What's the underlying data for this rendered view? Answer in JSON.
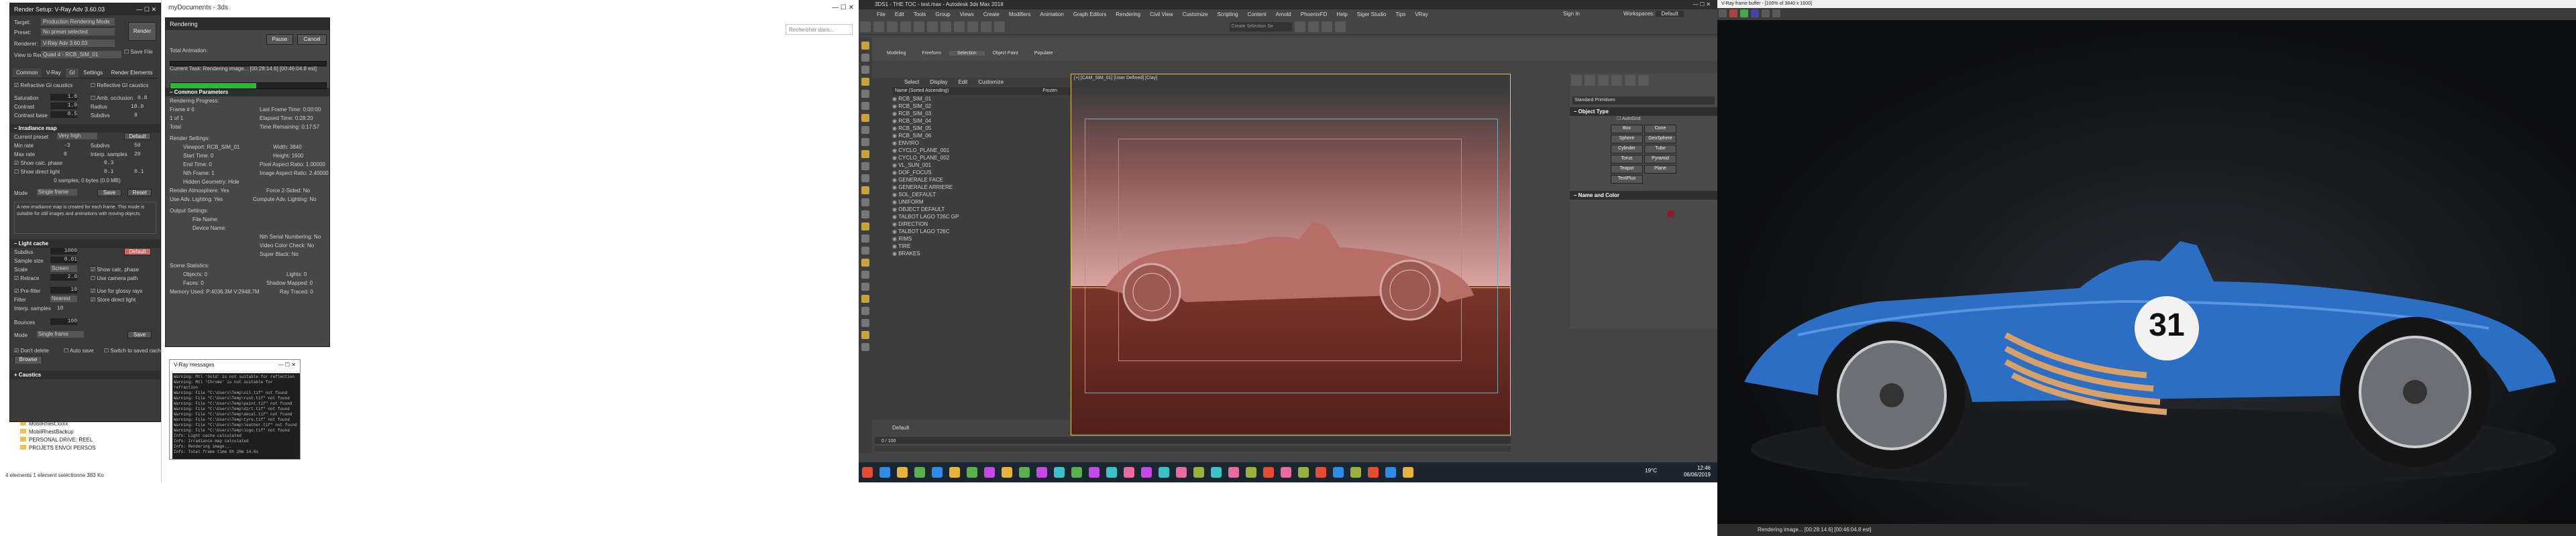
{
  "explorer": {
    "path": "myDocuments - 3ds",
    "search_placeholder": "Rechercher dans...",
    "folders": [
      "MobilRhest.xxxx",
      "MobilRhestBackup",
      "PERSONAL DRIVE: REEL",
      "PROJETS ENVOI PERSOS"
    ],
    "status": "4 elements   1 element selectionne 383 Ko"
  },
  "render_setup": {
    "title": "Render Setup: V-Ray Adv 3.60.03",
    "target_label": "Target:",
    "target_value": "Production Rendering Mode",
    "preset_label": "Preset:",
    "preset_value": "No preset selected",
    "renderer_label": "Renderer:",
    "renderer_value": "V-Ray Adv 3.60.03",
    "view_label": "View to Render:",
    "view_value": "Quad 4 - RCB_SIM_01",
    "render_button": "Render",
    "save_file": "Save File",
    "tabs": [
      "Common",
      "V-Ray",
      "GI",
      "Settings",
      "Render Elements"
    ],
    "refractive_gi": "Refractive GI caustics",
    "reflective_gi": "Reflective GI caustics",
    "saturation_label": "Saturation",
    "saturation_value": "1.0",
    "contrast_label": "Contrast",
    "contrast_value": "1.0",
    "contrast_base_label": "Contrast base",
    "contrast_base_value": "0.5",
    "amb_occlusion": "Amb. occlusion",
    "amb_value": "0.8",
    "radius_label": "Radius",
    "radius_value": "10.0",
    "subdivs_label": "Subdivs",
    "subdivs_value": "8",
    "irradiance_title": "Irradiance map",
    "current_preset_label": "Current preset",
    "current_preset_value": "Very high",
    "default_btn": "Default",
    "min_rate_label": "Min rate",
    "min_rate_value": "-3",
    "max_rate_label": "Max rate",
    "max_rate_value": "0",
    "subdivs2_value": "50",
    "interp_label": "Interp. samples",
    "interp_value": "20",
    "color_thresh_value": "0.3",
    "normal_thresh_value": "0.1",
    "dist_thresh_value": "0.1",
    "show_calc": "Show calc. phase",
    "show_direct": "Show direct light",
    "samples_info": "0 samples; 0 bytes (0.0 MB)",
    "mode_label": "Mode",
    "mode_value": "Single frame",
    "save_btn": "Save",
    "reset_btn": "Reset",
    "info_text": "A new irradiance map is created for each frame. This mode is suitable for still images and animations with moving objects.",
    "light_cache_title": "Light cache",
    "lc_subdivs_label": "Subdivs",
    "lc_subdivs_value": "1000",
    "lc_sample_label": "Sample size",
    "lc_sample_value": "0.01",
    "lc_scale_label": "Scale",
    "lc_scale_value": "Screen",
    "lc_retrace_label": "Retrace",
    "lc_retrace_value": "2.0",
    "show_calc2": "Show calc. phase",
    "use_camera": "Use camera path",
    "pre_filter": "Pre-filter",
    "pre_filter_value": "10",
    "filter_label": "Filter",
    "filter_value": "Nearest",
    "use_glossy": "Use for glossy rays",
    "store_direct": "Store direct light",
    "interp_samples_value": "10",
    "bounces_label": "Bounces",
    "bounces_value": "100",
    "mode2_value": "Single frame",
    "save2": "Save",
    "caustics_title": "Caustics",
    "auto_switch": "Don't delete",
    "auto_save": "Auto save",
    "switch_to_saved": "Switch to saved cache",
    "browse": "Browse"
  },
  "rendering_dialog": {
    "title": "Rendering",
    "pause": "Pause",
    "cancel": "Cancel",
    "total_animation": "Total Animation:",
    "current_task": "Current Task: Rendering image... [00:28:14.6] [00:46:04.8 est]",
    "progress": 0.55,
    "common_params": "Common Parameters",
    "rendering_progress": "Rendering Progress:",
    "frame_label": "Frame #",
    "frame_value": "0",
    "of_label": "1 of 1",
    "total_label": "Total",
    "last_frame_time": "Last Frame Time: 0:00:00",
    "elapsed_time": "Elapsed Time: 0:28:20",
    "time_remaining": "Time Remaining: 0:17:57",
    "render_settings": "Render Settings:",
    "viewport": "Viewport: RCB_SIM_01",
    "width": "Width: 3840",
    "height": "Height: 1600",
    "start_time": "Start Time: 0",
    "pixel_aspect": "Pixel Aspect Ratio: 1.00000",
    "end_time": "End Time: 0",
    "image_aspect": "Image Aspect Ratio: 2.40000",
    "nth_frame": "Nth Frame: 1",
    "hidden_geometry": "Hidden Geometry: Hide",
    "render_atmos": "Render Atmosphere: Yes",
    "force_2sided": "Force 2-Sided: No",
    "area_lights": "Use Adv. Lighting: Yes",
    "compute_adv": "Compute Adv. Lighting: No",
    "output_settings": "Output Settings:",
    "file_name": "File Name:",
    "device_name": "Device Name:",
    "nth_serial": "Nth Serial Numbering: No",
    "output_video": "Video Color Check: No",
    "super_black": "Super Black: No",
    "scene_statistics": "Scene Statistics:",
    "objects": "Objects: 0",
    "lights": "Lights: 0",
    "faces": "Faces: 0",
    "shadow_mapped": "Shadow Mapped: 0",
    "memory_used": "Memory Used: P:4036.3M V:2948.7M",
    "ray_traced": "Ray Traced: 0"
  },
  "vray_messages": {
    "title": "V-Ray messages",
    "lines": [
      "Warning: Mtl 'Gold' is not suitable for reflection",
      "Warning: Mtl 'Chrome' is not suitable for refraction",
      "Warning: File \"C:\\Users\\Temp\\oil.tif\" not found",
      "Warning: File \"C:\\Users\\Temp\\rust.tif\" not found",
      "Warning: File \"C:\\Users\\Temp\\paint.tif\" not found",
      "Warning: File \"C:\\Users\\Temp\\dirt.tif\" not found",
      "Warning: File \"C:\\Users\\Temp\\decal.tif\" not found",
      "Warning: File \"C:\\Users\\Temp\\tyre.tif\" not found",
      "Warning: File \"C:\\Users\\Temp\\leather.tif\" not found",
      "Warning: File \"C:\\Users\\Temp\\logo.tif\" not found",
      "Info: Light cache calculated",
      "Info: Irradiance map calculated",
      "Info: Rendering image...",
      "Info: Total frame time 0h 28m 14.6s"
    ]
  },
  "max": {
    "title": "3DS1 - THE TOC - test.max - Autodesk 3ds Max 2018",
    "menus": [
      "File",
      "Edit",
      "Tools",
      "Group",
      "Views",
      "Create",
      "Modifiers",
      "Animation",
      "Graph Editors",
      "Rendering",
      "Civil View",
      "Customize",
      "Scripting",
      "Content",
      "Arnold",
      "PhoenixFD",
      "Help",
      "Siger Studio",
      "Tips",
      "VRay"
    ],
    "selection_set_placeholder": "Create Selection Se",
    "sign_in": "Sign In",
    "workspaces_label": "Workspaces:",
    "workspaces_value": "Default",
    "ribbon_tabs": [
      "Modeling",
      "Freeform",
      "Selection",
      "Object Paint",
      "Populate"
    ],
    "explorer_tabs": [
      "Select",
      "Display",
      "Edit",
      "Customize"
    ],
    "name_column": "Name (Sorted Ascending)",
    "frozen_column": "Frozen",
    "scene_items": [
      "RCB_SIM_01",
      "RCB_SIM_02",
      "RCB_SIM_03",
      "RCB_SIM_04",
      "RCB_SIM_05",
      "RCB_SIM_06",
      "ENVIRO",
      "CYCLO_PLANE_001",
      "CYCLO_PLANE_002",
      "VL_SUN_001",
      "DOF_FOCUS",
      "GENERALE FACE",
      "GENERALE ARRIERE",
      "SOL_DEFAULT",
      "UNIFORM",
      "OBJECT DEFAULT",
      "TALBOT LAGO T26C GP",
      "DIRECTION",
      "TALBOT LAGO T26C",
      "RIMS",
      "TIRE",
      "BRAKES"
    ],
    "viewport_label": "[+] [CAM_SIM_01] [User Defined] [Clay]",
    "default_label": "Default",
    "frame_counter": "0 / 100",
    "command_panel_title": "Standard Primitives",
    "object_type": "Object Type",
    "autogrid": "AutoGrid",
    "primitives": [
      "Box",
      "Cone",
      "Sphere",
      "GeoSphere",
      "Cylinder",
      "Tube",
      "Torus",
      "Pyramid",
      "Teapot",
      "Plane",
      "TextPlus"
    ],
    "name_color": "Name and Color"
  },
  "frame_buffer": {
    "title": "V-Ray frame buffer - [100% of 3840 x 1600]",
    "car_number": "31",
    "status": "Rendering image... [00:28:14.6] [00:46:04.8 est]"
  },
  "taskbar": {
    "time": "12:46",
    "date": "06/06/2019",
    "temperature": "19°C",
    "colors": [
      "#e84a32",
      "#2d8ce8",
      "#e8b33a",
      "#5ab04a",
      "#c44ae8",
      "#3ac2c9",
      "#e86aa0",
      "#9ab03a"
    ]
  }
}
